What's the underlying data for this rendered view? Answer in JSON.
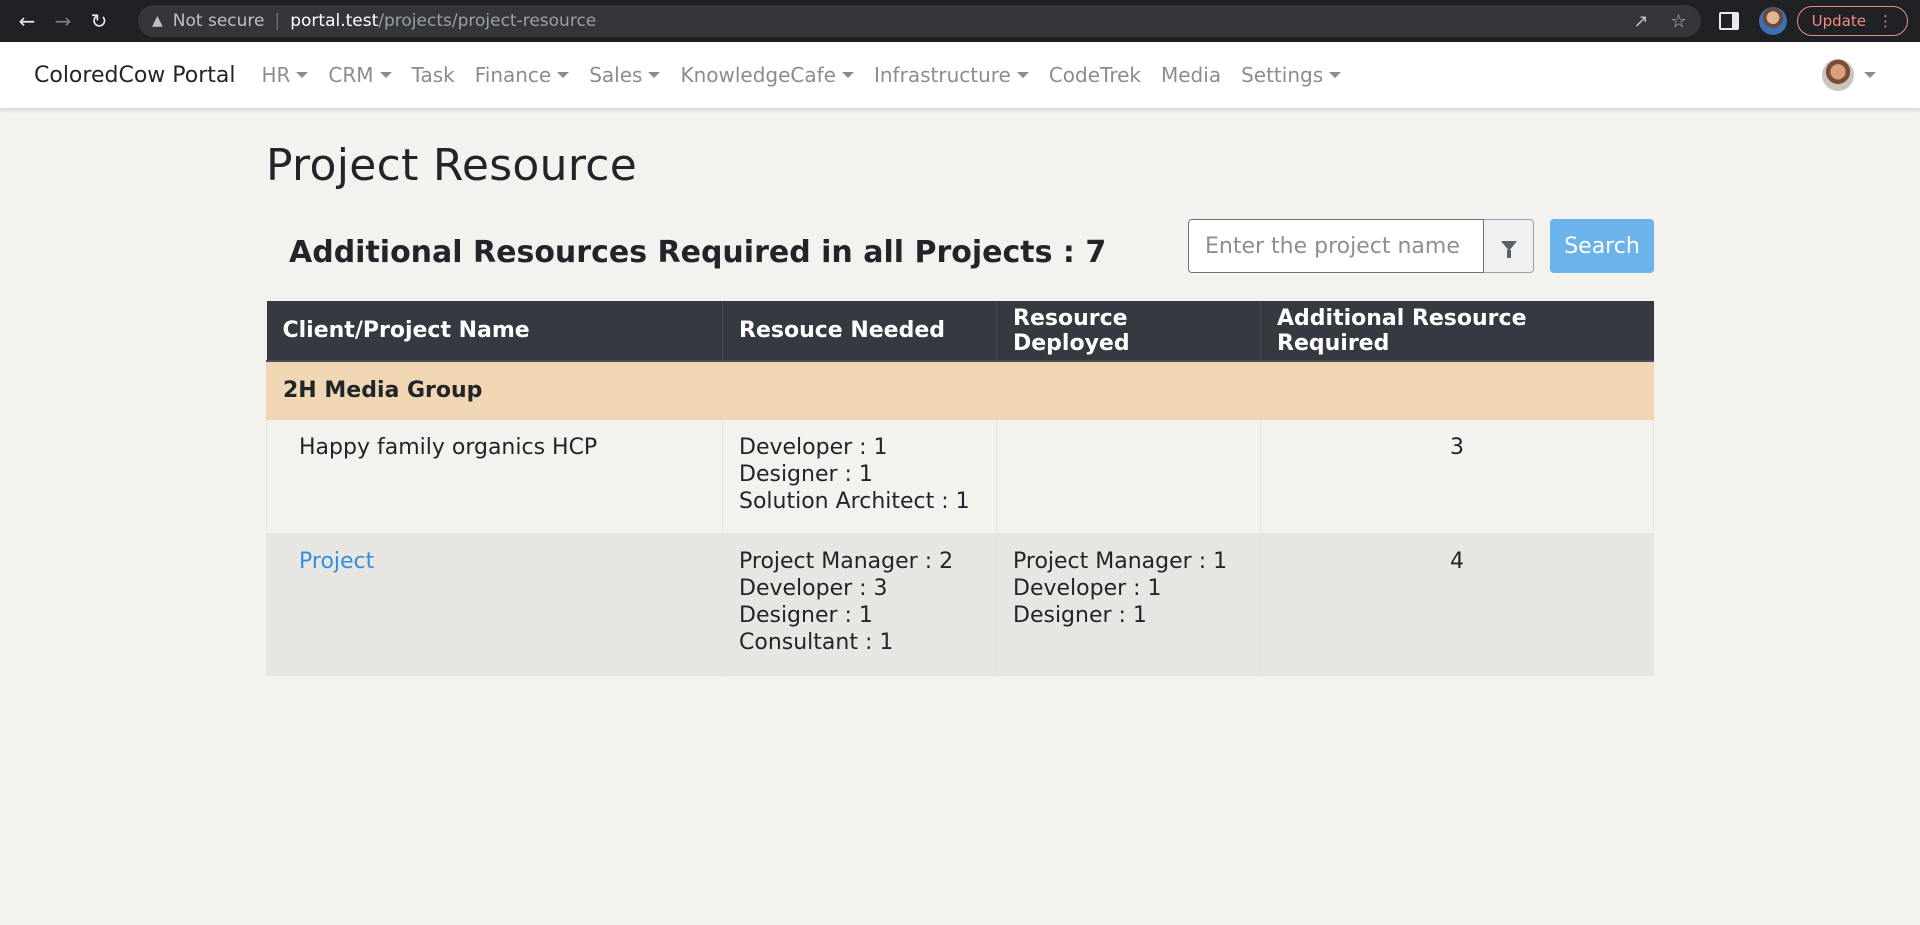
{
  "browser": {
    "not_secure": "Not secure",
    "url_host": "portal.test",
    "url_path": "/projects/project-resource",
    "update_label": "Update"
  },
  "navbar": {
    "brand": "ColoredCow Portal",
    "items": [
      {
        "label": "HR",
        "dropdown": true
      },
      {
        "label": "CRM",
        "dropdown": true
      },
      {
        "label": "Task",
        "dropdown": false
      },
      {
        "label": "Finance",
        "dropdown": true
      },
      {
        "label": "Sales",
        "dropdown": true
      },
      {
        "label": "KnowledgeCafe",
        "dropdown": true
      },
      {
        "label": "Infrastructure",
        "dropdown": true
      },
      {
        "label": "CodeTrek",
        "dropdown": false
      },
      {
        "label": "Media",
        "dropdown": false
      },
      {
        "label": "Settings",
        "dropdown": true
      }
    ]
  },
  "page": {
    "title": "Project Resource",
    "summary": "Additional Resources Required in all Projects : 7"
  },
  "search": {
    "placeholder": "Enter the project name",
    "button_label": "Search"
  },
  "table": {
    "headers": [
      "Client/Project Name",
      "Resouce Needed",
      "Resource Deployed",
      "Additional Resource Required"
    ],
    "group": "2H Media Group",
    "rows": [
      {
        "name": "Happy family organics HCP",
        "needed": [
          "Developer : 1",
          "Designer : 1",
          "Solution Architect : 1"
        ],
        "deployed": [
          "",
          "",
          ""
        ],
        "additional": "3"
      },
      {
        "name": "Project",
        "needed": [
          "Project Manager : 2",
          "Developer : 3",
          "Designer : 1",
          "Consultant : 1"
        ],
        "deployed": [
          "Project Manager : 1",
          "Developer : 1",
          "Designer : 1"
        ],
        "additional": "4"
      }
    ]
  },
  "colors": {
    "navbar_bg": "#ffffff",
    "table_header_bg": "#343a40",
    "group_row_bg": "#f1d6b4",
    "link": "#3490dc",
    "search_button": "#6cb2eb"
  }
}
